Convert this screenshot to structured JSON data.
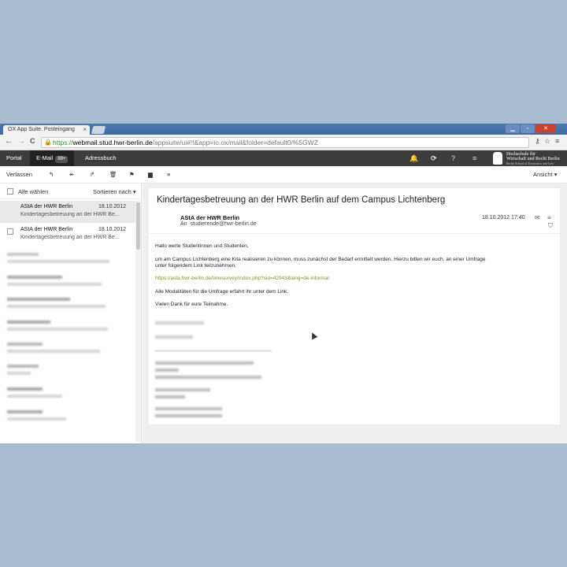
{
  "browser": {
    "tab_title": "OX App Suite. Posteingang",
    "tab_close": "×",
    "url_scheme": "https://",
    "url_host": "webmail.stud.hwr-berlin.de",
    "url_path": "/appsuite/ui#!!&app=io.ox/mail&folder=default0/%5GWZ",
    "back": "←",
    "forward": "→",
    "reload": "C",
    "lock_icon": "lock-icon",
    "star_icon": "star-icon",
    "menu_icon": "menu-icon"
  },
  "appbar": {
    "portal": "Portal",
    "email": "E-Mail",
    "email_badge": "99+",
    "addressbook": "Adressbuch",
    "logo_line1": "Hochschule für",
    "logo_line2": "Wirtschaft und Recht Berlin",
    "logo_line3": "Berlin School of Economics and Law"
  },
  "toolbar": {
    "leave": "Verlassen",
    "view": "Ansicht"
  },
  "list": {
    "select_all": "Alle wählen",
    "sort": "Sortieren nach",
    "items": [
      {
        "from": "AStA der HWR Berlin",
        "date": "18.10.2012",
        "subject": "Kindertagesbetreuung an der HWR Be..."
      },
      {
        "from": "AStA der HWR Berlin",
        "date": "18.10.2012",
        "subject": "Kindertagesbetreuung an der HWR Be..."
      }
    ]
  },
  "mail": {
    "subject": "Kindertagesbetreuung an der HWR Berlin auf dem Campus Lichtenberg",
    "sender": "AStA der HWR Berlin",
    "to_label": "An",
    "to_value": "studierende@hwr-berlin.de",
    "date": "18.10.2012 17:40",
    "greeting": "Hallo werte Studentinnen und Studenten,",
    "para1": "um am Campus Lichtenberg eine Kita realisieren zu können, muss zunächst der Bedarf ermittelt werden. Hierzu bitten wir euch, an einer Umfrage",
    "para1b": "unter folgendem Link teilzunehmen.",
    "link": "https://asta.hwr-berlin.de/limesurvey/index.php?sid=42943&lang=de-informal",
    "para2": "Alle Modalitäten für die Umfrage erfahrt ihr unter dem Link.",
    "thanks": "Vielen Dank für eure Teilnahme."
  }
}
